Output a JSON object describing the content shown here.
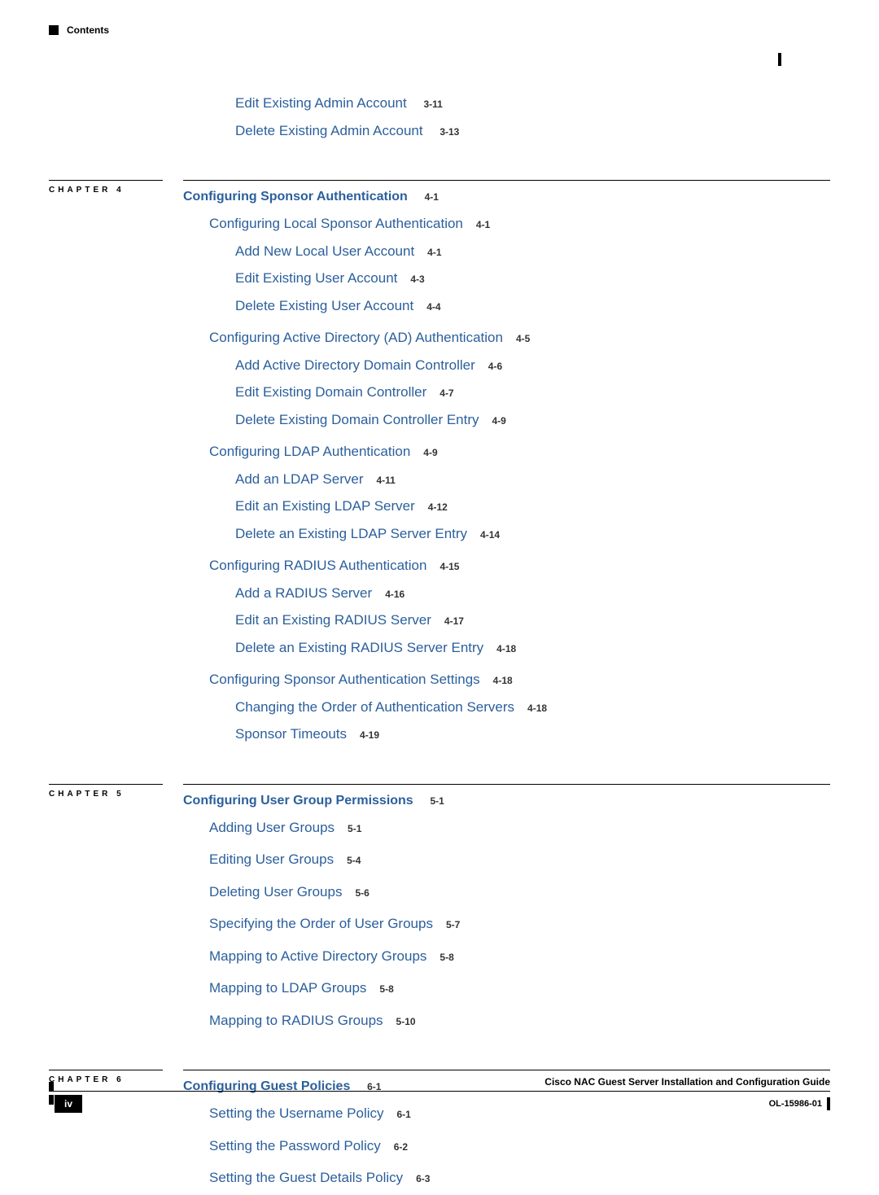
{
  "header": {
    "label": "Contents"
  },
  "prelude": [
    {
      "text": "Edit Existing Admin Account",
      "page": "3-11",
      "indent": 2
    },
    {
      "text": "Delete Existing Admin Account",
      "page": "3-13",
      "indent": 2
    }
  ],
  "chapter4": {
    "label": "CHAPTER 4",
    "title": "Configuring Sponsor Authentication",
    "title_page": "4-1",
    "items": [
      {
        "text": "Configuring Local Sponsor Authentication",
        "page": "4-1",
        "indent": 1,
        "gap": false
      },
      {
        "text": "Add New Local User Account",
        "page": "4-1",
        "indent": 2,
        "gap": false
      },
      {
        "text": "Edit Existing User Account",
        "page": "4-3",
        "indent": 2,
        "gap": false
      },
      {
        "text": "Delete Existing User Account",
        "page": "4-4",
        "indent": 2,
        "gap": false
      },
      {
        "text": "Configuring Active Directory (AD) Authentication",
        "page": "4-5",
        "indent": 1,
        "gap": true
      },
      {
        "text": "Add Active Directory Domain Controller",
        "page": "4-6",
        "indent": 2,
        "gap": false
      },
      {
        "text": "Edit Existing Domain Controller",
        "page": "4-7",
        "indent": 2,
        "gap": false
      },
      {
        "text": "Delete Existing Domain Controller Entry",
        "page": "4-9",
        "indent": 2,
        "gap": false
      },
      {
        "text": "Configuring LDAP Authentication",
        "page": "4-9",
        "indent": 1,
        "gap": true
      },
      {
        "text": "Add an LDAP Server",
        "page": "4-11",
        "indent": 2,
        "gap": false
      },
      {
        "text": "Edit an Existing LDAP Server",
        "page": "4-12",
        "indent": 2,
        "gap": false
      },
      {
        "text": "Delete an Existing LDAP Server Entry",
        "page": "4-14",
        "indent": 2,
        "gap": false
      },
      {
        "text": "Configuring RADIUS Authentication",
        "page": "4-15",
        "indent": 1,
        "gap": true
      },
      {
        "text": "Add a RADIUS Server",
        "page": "4-16",
        "indent": 2,
        "gap": false
      },
      {
        "text": "Edit an Existing RADIUS Server",
        "page": "4-17",
        "indent": 2,
        "gap": false
      },
      {
        "text": "Delete an Existing RADIUS Server Entry",
        "page": "4-18",
        "indent": 2,
        "gap": false
      },
      {
        "text": "Configuring Sponsor Authentication Settings",
        "page": "4-18",
        "indent": 1,
        "gap": true
      },
      {
        "text": "Changing the Order of Authentication Servers",
        "page": "4-18",
        "indent": 2,
        "gap": false
      },
      {
        "text": "Sponsor Timeouts",
        "page": "4-19",
        "indent": 2,
        "gap": false
      }
    ]
  },
  "chapter5": {
    "label": "CHAPTER 5",
    "title": "Configuring User Group Permissions",
    "title_page": "5-1",
    "items": [
      {
        "text": "Adding User Groups",
        "page": "5-1",
        "indent": 1,
        "gap": false
      },
      {
        "text": "Editing User Groups",
        "page": "5-4",
        "indent": 1,
        "gap": true
      },
      {
        "text": "Deleting User Groups",
        "page": "5-6",
        "indent": 1,
        "gap": true
      },
      {
        "text": "Specifying the Order of User Groups",
        "page": "5-7",
        "indent": 1,
        "gap": true
      },
      {
        "text": "Mapping to Active Directory Groups",
        "page": "5-8",
        "indent": 1,
        "gap": true
      },
      {
        "text": "Mapping to LDAP Groups",
        "page": "5-8",
        "indent": 1,
        "gap": true
      },
      {
        "text": "Mapping to RADIUS Groups",
        "page": "5-10",
        "indent": 1,
        "gap": true
      }
    ]
  },
  "chapter6": {
    "label": "CHAPTER 6",
    "title": "Configuring Guest Policies",
    "title_page": "6-1",
    "items": [
      {
        "text": "Setting the Username Policy",
        "page": "6-1",
        "indent": 1,
        "gap": false
      },
      {
        "text": "Setting the Password Policy",
        "page": "6-2",
        "indent": 1,
        "gap": true
      },
      {
        "text": "Setting the Guest Details Policy",
        "page": "6-3",
        "indent": 1,
        "gap": true
      }
    ]
  },
  "footer": {
    "title": "Cisco NAC Guest Server Installation and Configuration Guide",
    "page": "iv",
    "docid": "OL-15986-01"
  }
}
